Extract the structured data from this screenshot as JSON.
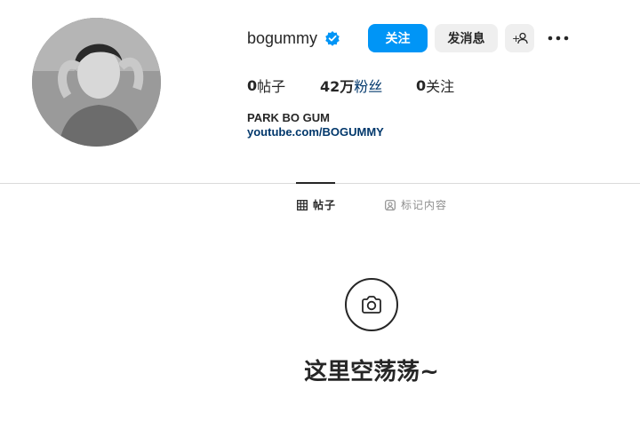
{
  "profile": {
    "username": "bogummy",
    "verified": true,
    "full_name": "PARK BO GUM",
    "link": "youtube.com/BOGUMMY"
  },
  "actions": {
    "follow_label": "关注",
    "message_label": "发消息",
    "add_user_label": "+ ",
    "more_label": "•••"
  },
  "stats": {
    "posts_num": "0",
    "posts_label": "帖子",
    "followers_num": "42万",
    "followers_label": "粉丝",
    "following_num": "0",
    "following_label": "关注"
  },
  "tabs": [
    {
      "label": "帖子",
      "icon": "grid-icon",
      "active": true
    },
    {
      "label": "标记内容",
      "icon": "tagged-icon",
      "active": false
    }
  ],
  "empty_state": {
    "icon": "camera-icon",
    "text": "这里空荡荡~"
  },
  "colors": {
    "accent": "#0095f6",
    "link": "#00376b",
    "button_gray": "#efefef",
    "divider": "#dbdbdb"
  }
}
